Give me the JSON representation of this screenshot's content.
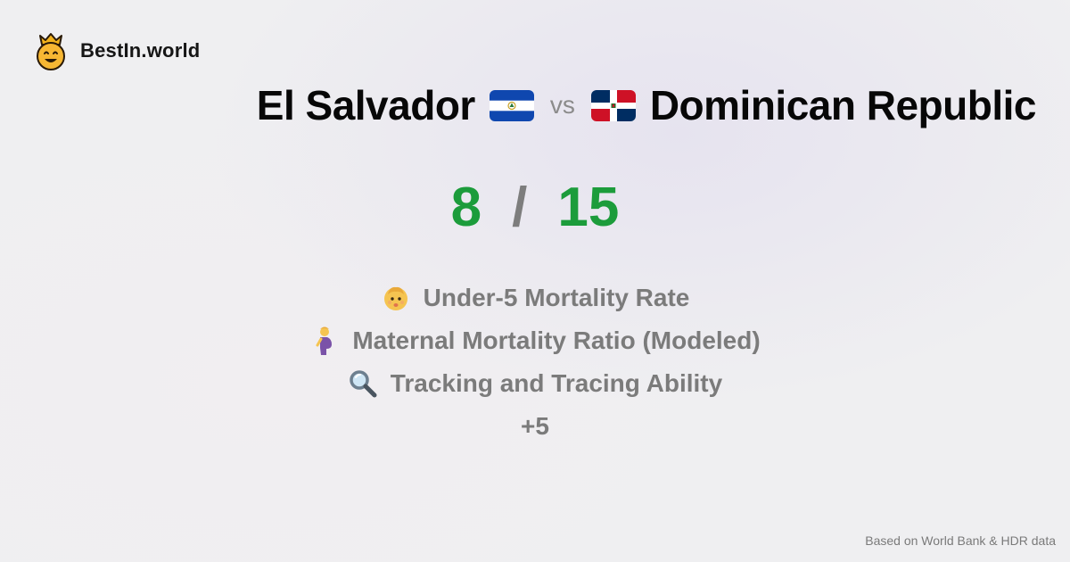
{
  "brand": {
    "name": "BestIn.world",
    "logo_icon": "crowned-smiley-icon"
  },
  "header": {
    "country_a": "El Salvador",
    "country_a_flag": "el-salvador-flag-icon",
    "vs_label": "vs",
    "country_b": "Dominican Republic",
    "country_b_flag": "dominican-republic-flag-icon"
  },
  "score": {
    "a": "8",
    "separator": "/",
    "b": "15",
    "color": "#1c9c3b"
  },
  "metrics": [
    {
      "icon": "baby-icon",
      "label": "Under-5 Mortality Rate"
    },
    {
      "icon": "pregnant-woman-icon",
      "label": "Maternal Mortality Ratio (Modeled)"
    },
    {
      "icon": "magnifying-glass-icon",
      "label": "Tracking and Tracing Ability"
    }
  ],
  "more_label": "+5",
  "footer": {
    "source": "Based on World Bank & HDR data"
  }
}
